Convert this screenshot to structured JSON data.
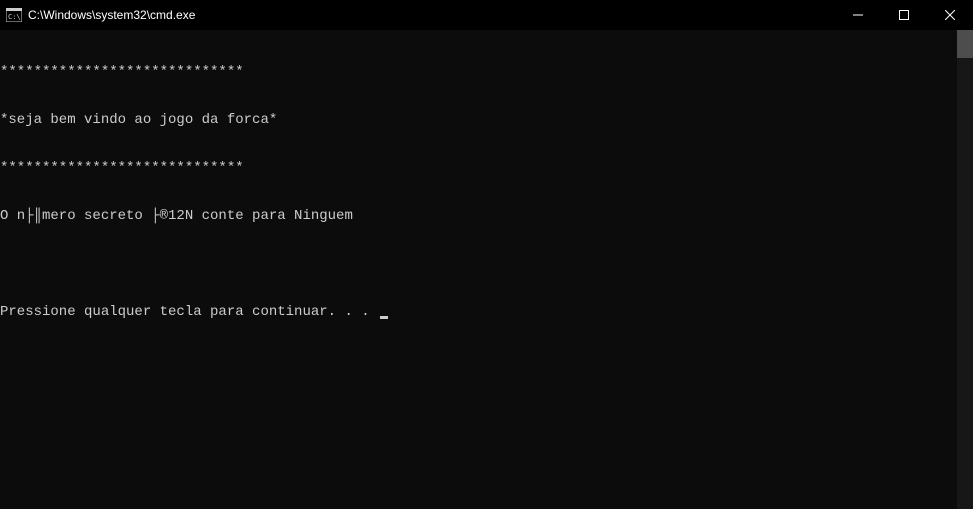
{
  "titlebar": {
    "title": "C:\\Windows\\system32\\cmd.exe"
  },
  "console": {
    "lines": [
      "*****************************",
      "*seja bem vindo ao jogo da forca*",
      "*****************************",
      "O n├║mero secreto ├®12N conte para Ninguem",
      "",
      "Pressione qualquer tecla para continuar. . . "
    ]
  }
}
